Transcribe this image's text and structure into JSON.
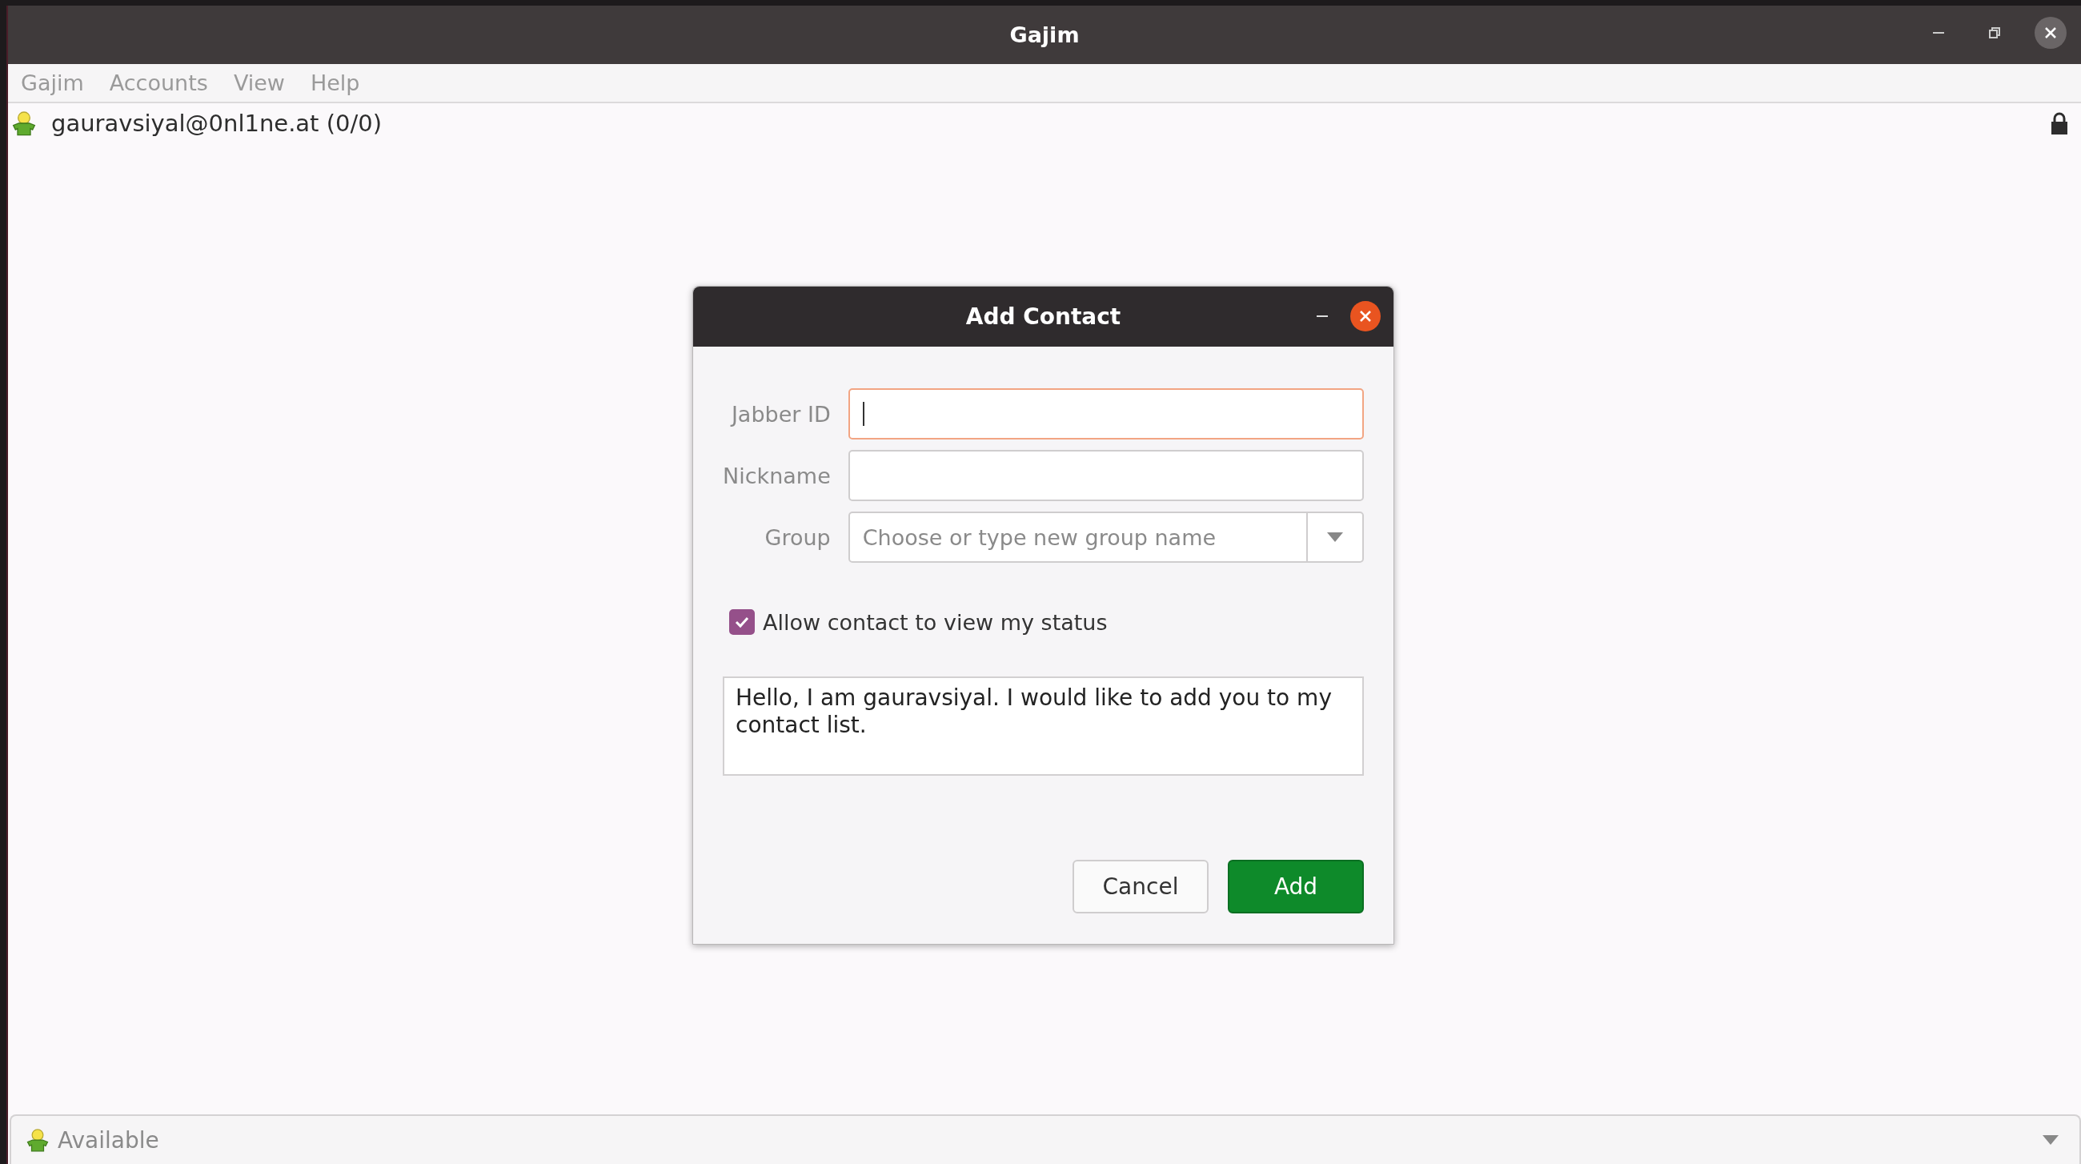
{
  "window": {
    "title": "Gajim"
  },
  "menu": [
    {
      "label": "Gajim"
    },
    {
      "label": "Accounts"
    },
    {
      "label": "View"
    },
    {
      "label": "Help"
    }
  ],
  "account": {
    "label": "gauravsiyal@0nl1ne.at (0/0)"
  },
  "dialog": {
    "title": "Add Contact",
    "fields": [
      {
        "label": "Jabber ID",
        "kind": "text",
        "focused": true
      },
      {
        "label": "Nickname",
        "kind": "text",
        "focused": false
      },
      {
        "label": "Group",
        "kind": "combo",
        "focused": false,
        "placeholder": "Choose or type new group name"
      }
    ],
    "checkbox": {
      "label": "Allow contact to view my status",
      "checked": true
    },
    "message": "Hello, I am gauravsiyal. I would like to add you to my contact list.",
    "buttons": [
      {
        "label": "Cancel",
        "kind": "secondary"
      },
      {
        "label": "Add",
        "kind": "primary"
      }
    ]
  },
  "status_bar": {
    "label": "Available"
  }
}
